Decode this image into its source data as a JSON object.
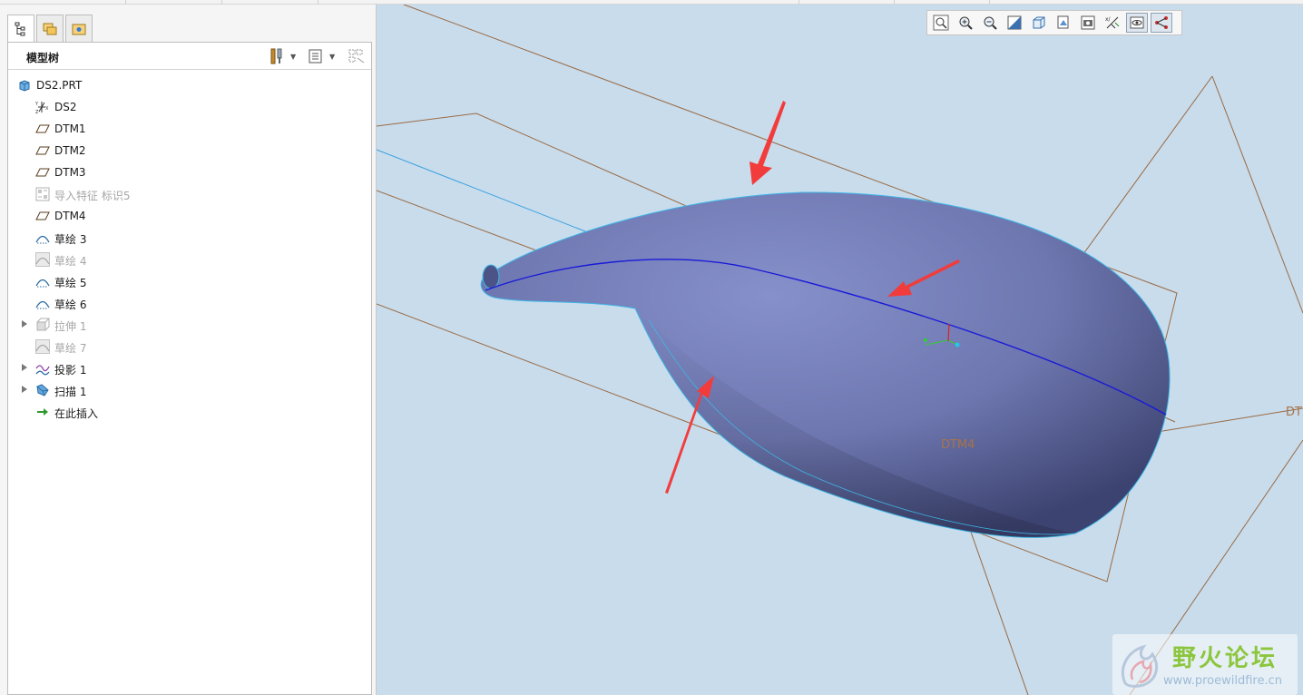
{
  "model_tree": {
    "tabs": [
      "model-tree-tab",
      "layer-tab",
      "favorites-tab"
    ],
    "title": "模型树",
    "items": [
      {
        "label": "DS2.PRT",
        "icon": "part-icon",
        "enabled": true,
        "expandable": false
      },
      {
        "label": "DS2",
        "icon": "csys-icon",
        "enabled": true,
        "expandable": false
      },
      {
        "label": "DTM1",
        "icon": "datum-plane-icon",
        "enabled": true,
        "expandable": false
      },
      {
        "label": "DTM2",
        "icon": "datum-plane-icon",
        "enabled": true,
        "expandable": false
      },
      {
        "label": "DTM3",
        "icon": "datum-plane-icon",
        "enabled": true,
        "expandable": false
      },
      {
        "label": "导入特征 标识5",
        "icon": "import-feature-icon",
        "enabled": false,
        "expandable": false
      },
      {
        "label": "DTM4",
        "icon": "datum-plane-icon",
        "enabled": true,
        "expandable": false
      },
      {
        "label": "草绘 3",
        "icon": "sketch-icon",
        "enabled": true,
        "expandable": false
      },
      {
        "label": "草绘 4",
        "icon": "sketch-icon",
        "enabled": false,
        "expandable": false
      },
      {
        "label": "草绘 5",
        "icon": "sketch-icon",
        "enabled": true,
        "expandable": false
      },
      {
        "label": "草绘 6",
        "icon": "sketch-icon",
        "enabled": true,
        "expandable": false
      },
      {
        "label": "拉伸 1",
        "icon": "extrude-icon",
        "enabled": false,
        "expandable": true
      },
      {
        "label": "草绘 7",
        "icon": "sketch-icon",
        "enabled": false,
        "expandable": false
      },
      {
        "label": "投影 1",
        "icon": "projection-icon",
        "enabled": true,
        "expandable": true
      },
      {
        "label": "扫描 1",
        "icon": "sweep-icon",
        "enabled": true,
        "expandable": true
      },
      {
        "label": "在此插入",
        "icon": "insert-here-icon",
        "enabled": true,
        "expandable": false
      }
    ]
  },
  "view_toolbar": [
    "refit-icon",
    "zoom-in-icon",
    "zoom-out-icon",
    "repaint-icon",
    "display-style-icon",
    "saved-views-icon",
    "view-manager-icon",
    "datum-display-icon",
    "spin-center-icon",
    "annotation-display-icon"
  ],
  "viewport": {
    "labels": {
      "dtm4": "DTM4",
      "dt": "DT"
    },
    "background": "#c8dcec",
    "model_color": "#6f78b2",
    "arrow_color": "#f23c3c",
    "plane_color": "#9a6a43"
  },
  "watermark": {
    "title": "野火论坛",
    "url": "www.proewildfire.cn"
  }
}
